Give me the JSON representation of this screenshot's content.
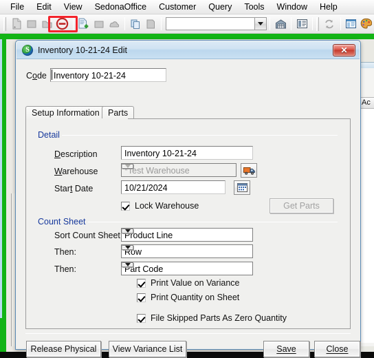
{
  "menubar": {
    "items": [
      {
        "label": "File"
      },
      {
        "label": "Edit"
      },
      {
        "label": "View"
      },
      {
        "label": "SedonaOffice"
      },
      {
        "label": "Customer"
      },
      {
        "label": "Query"
      },
      {
        "label": "Tools"
      },
      {
        "label": "Window"
      },
      {
        "label": "Help"
      }
    ]
  },
  "toolbar": {
    "combo_value": "",
    "highlight_color": "#f4242c",
    "buttons": [
      {
        "name": "new-document-icon"
      },
      {
        "name": "save-icon"
      },
      {
        "name": "folder-icon"
      },
      {
        "name": "cancel-icon"
      },
      {
        "name": "new-record-icon"
      },
      {
        "name": "note-icon"
      },
      {
        "name": "cloud-icon"
      },
      {
        "name": "copy-icon"
      },
      {
        "name": "paste-icon"
      },
      {
        "name": "warehouse-icon"
      },
      {
        "name": "details-pane-icon"
      },
      {
        "name": "refresh-icon"
      },
      {
        "name": "tree-view-icon"
      },
      {
        "name": "palette-icon"
      }
    ]
  },
  "background_window": {
    "column_header": "Ac"
  },
  "dialog": {
    "title": "Inventory 10-21-24 Edit",
    "icon": "sedona-logo-icon",
    "close_label": "✕",
    "code": {
      "label": "Code",
      "label_accel": "o",
      "value": "Inventory 10-21-24"
    },
    "tabs": [
      {
        "label": "Setup Information",
        "active": true
      },
      {
        "label": "Parts",
        "active": false
      }
    ],
    "detail": {
      "group_title": "Detail",
      "description": {
        "label": "Description",
        "accel": "D",
        "value": "Inventory 10-21-24"
      },
      "warehouse": {
        "label": "Warehouse",
        "accel": "W",
        "value": "*Test Warehouse",
        "disabled": true,
        "picker_icon": "warehouse-truck-icon"
      },
      "start_date": {
        "label": "Start Date",
        "accel": "t",
        "value": "10/21/2024",
        "picker_icon": "calendar-icon"
      },
      "lock_warehouse": {
        "label": "Lock Warehouse",
        "checked": true
      },
      "get_parts": {
        "label": "Get Parts",
        "accel": "G",
        "disabled": true
      }
    },
    "count_sheet": {
      "group_title": "Count Sheet",
      "sort_by": {
        "label": "Sort Count Sheet By:",
        "value": "Product Line"
      },
      "then_1": {
        "label": "Then:",
        "value": "Row"
      },
      "then_2": {
        "label": "Then:",
        "value": "Part Code"
      },
      "print_value_on_variance": {
        "label": "Print Value on Variance",
        "checked": true
      },
      "print_quantity_on_sheet": {
        "label": "Print Quantity on Sheet",
        "checked": true
      },
      "file_skipped_parts": {
        "label": "File Skipped Parts As Zero Quantity",
        "checked": true
      }
    },
    "footer": {
      "release_physical": "Release Physical",
      "view_variance_list": "View Variance List",
      "save": "Save",
      "save_accel": "S",
      "close": "Close",
      "close_accel": "C"
    }
  }
}
